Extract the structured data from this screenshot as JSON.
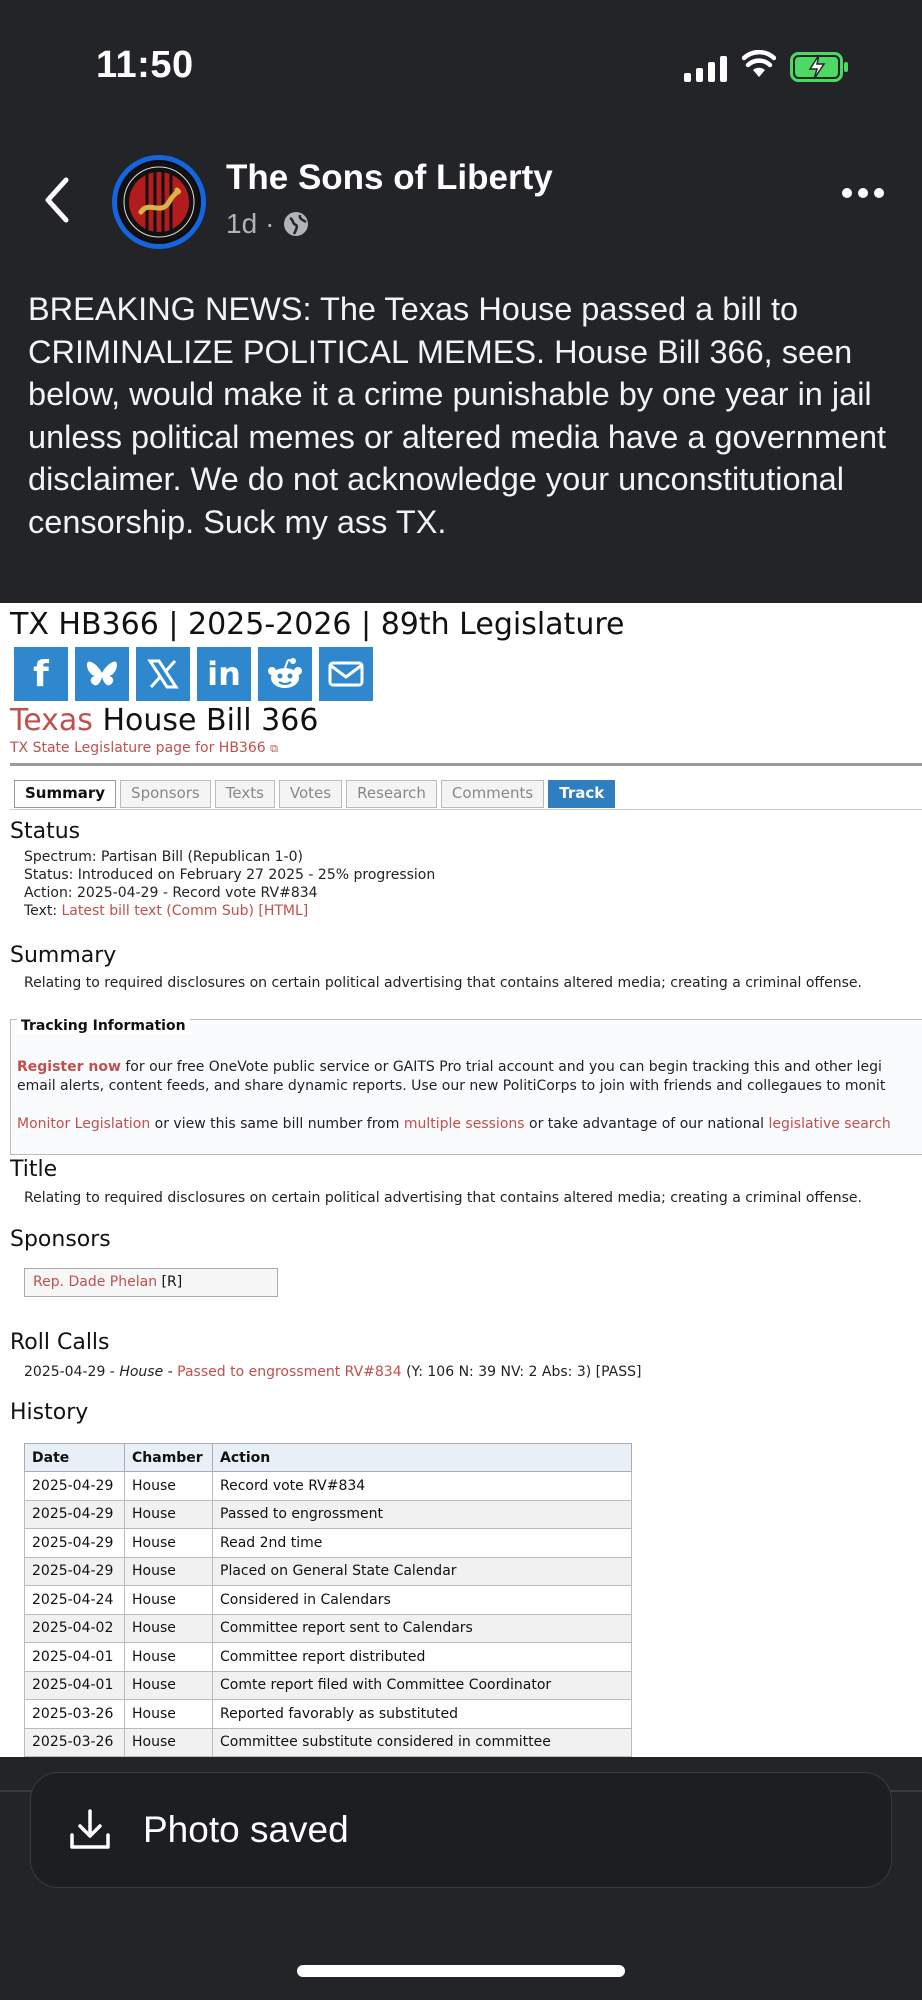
{
  "status_bar": {
    "time": "11:50"
  },
  "post": {
    "page_name": "The Sons of Liberty",
    "age": "1d",
    "separator": "·",
    "text": "BREAKING NEWS: The Texas House passed a bill to CRIMINALIZE POLITICAL MEMES. House Bill 366, seen below, would make it a crime punishable by one year in jail unless political memes or altered media have a government disclaimer. We do not acknowledge your unconstitutional censorship. Suck my ass TX."
  },
  "bill": {
    "header": "TX HB366 | 2025-2026 | 89th Legislature",
    "heading_state": "Texas",
    "heading_rest": " House Bill 366",
    "subtitle": "TX State Legislature page for HB366",
    "tabs": [
      "Summary",
      "Sponsors",
      "Texts",
      "Votes",
      "Research",
      "Comments",
      "Track"
    ],
    "status": {
      "heading": "Status",
      "spectrum": "Spectrum: Partisan Bill (Republican 1-0)",
      "status": "Status: Introduced on February 27 2025 - 25% progression",
      "action": "Action: 2025-04-29 - Record vote RV#834",
      "text_label": "Text: ",
      "text_link": "Latest bill text (Comm Sub) [HTML]"
    },
    "summary": {
      "heading": "Summary",
      "text": "Relating to required disclosures on certain political advertising that contains altered media; creating a criminal offense."
    },
    "tracking": {
      "legend": "Tracking Information",
      "register": "Register now",
      "line1": " for our free OneVote public service or GAITS Pro trial account and you can begin tracking this and other legi",
      "line2": "email alerts, content feeds, and share dynamic reports. Use our new PolitiCorps to join with friends and collegaues to monit",
      "monitor": "Monitor Legislation",
      "l3a": " or view this same bill number from ",
      "multiple": "multiple sessions",
      "l3b": " or take advantage of our national ",
      "legsearch": "legislative search"
    },
    "title": {
      "heading": "Title",
      "text": "Relating to required disclosures on certain political advertising that contains altered media; creating a criminal offense."
    },
    "sponsors": {
      "heading": "Sponsors",
      "name": "Rep. Dade Phelan",
      "party": " [R]"
    },
    "roll_calls": {
      "heading": "Roll Calls",
      "date": "2025-04-29 - ",
      "chamber": "House",
      "dash": " - ",
      "link": "Passed to engrossment RV#834",
      "result": " (Y: 106 N: 39 NV: 2 Abs: 3) [PASS]"
    },
    "history": {
      "heading": "History",
      "columns": [
        "Date",
        "Chamber",
        "Action"
      ],
      "rows": [
        [
          "2025-04-29",
          "House",
          "Record vote RV#834"
        ],
        [
          "2025-04-29",
          "House",
          "Passed to engrossment"
        ],
        [
          "2025-04-29",
          "House",
          "Read 2nd time"
        ],
        [
          "2025-04-29",
          "House",
          "Placed on General State Calendar"
        ],
        [
          "2025-04-24",
          "House",
          "Considered in Calendars"
        ],
        [
          "2025-04-02",
          "House",
          "Committee report sent to Calendars"
        ],
        [
          "2025-04-01",
          "House",
          "Committee report distributed"
        ],
        [
          "2025-04-01",
          "House",
          "Comte report filed with Committee Coordinator"
        ],
        [
          "2025-03-26",
          "House",
          "Reported favorably as substituted"
        ],
        [
          "2025-03-26",
          "House",
          "Committee substitute considered in committee"
        ]
      ]
    }
  },
  "toast": {
    "text": "Photo saved"
  },
  "colors": {
    "background": "#232427",
    "link": "#c0504d",
    "share": "#2f88ce",
    "avatar_ring": "#1466e0",
    "battery": "#4cd964"
  }
}
